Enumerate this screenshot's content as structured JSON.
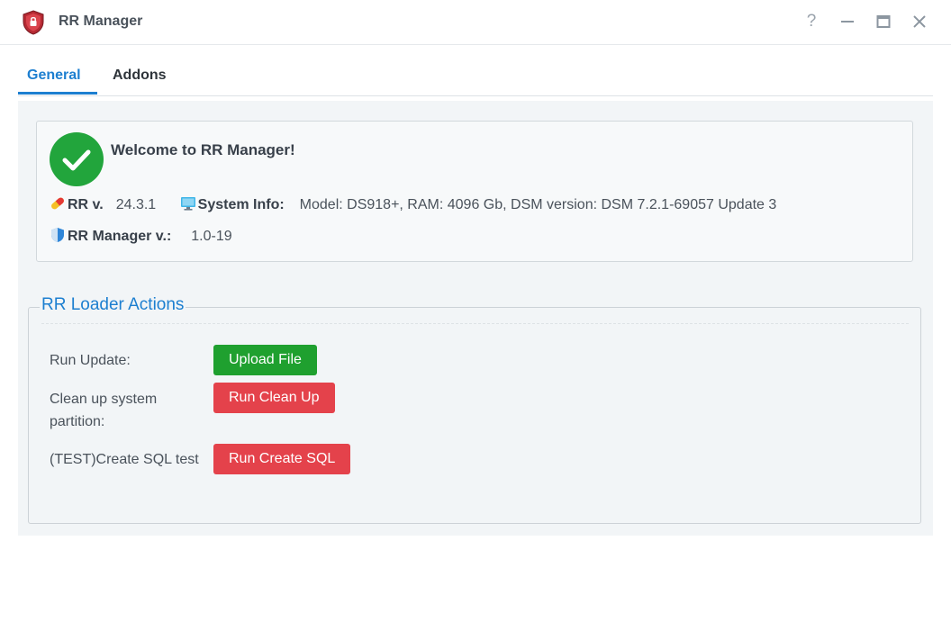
{
  "window": {
    "title": "RR Manager",
    "help_glyph": "?"
  },
  "tabs": [
    {
      "label": "General",
      "active": true
    },
    {
      "label": "Addons",
      "active": false
    }
  ],
  "welcome": {
    "title": "Welcome to RR Manager!",
    "rr_version_label": "RR v.",
    "rr_version_value": "24.3.1",
    "system_info_label": "System Info:",
    "system_info_value": "Model: DS918+, RAM: 4096 Gb, DSM version: DSM 7.2.1-69057 Update 3",
    "manager_version_label": "RR Manager v.:",
    "manager_version_value": "1.0-19"
  },
  "actions": {
    "legend": "RR Loader Actions",
    "items": [
      {
        "label": "Run Update:",
        "button": "Upload File",
        "button_color": "#1fa02f"
      },
      {
        "label": "Clean up system partition:",
        "button": "Run Clean Up",
        "button_color": "#e4424b"
      },
      {
        "label": "(TEST)Create SQL test",
        "button": "Run Create SQL",
        "button_color": "#e4424b"
      }
    ]
  },
  "colors": {
    "accent": "#1d7fd0",
    "success": "#22a53c",
    "danger": "#e4424b"
  },
  "icons": [
    "shield-app-icon",
    "help-icon",
    "minimize-icon",
    "maximize-icon",
    "close-icon",
    "checkmark-icon",
    "pill-icon",
    "monitor-icon",
    "shield-icon"
  ]
}
